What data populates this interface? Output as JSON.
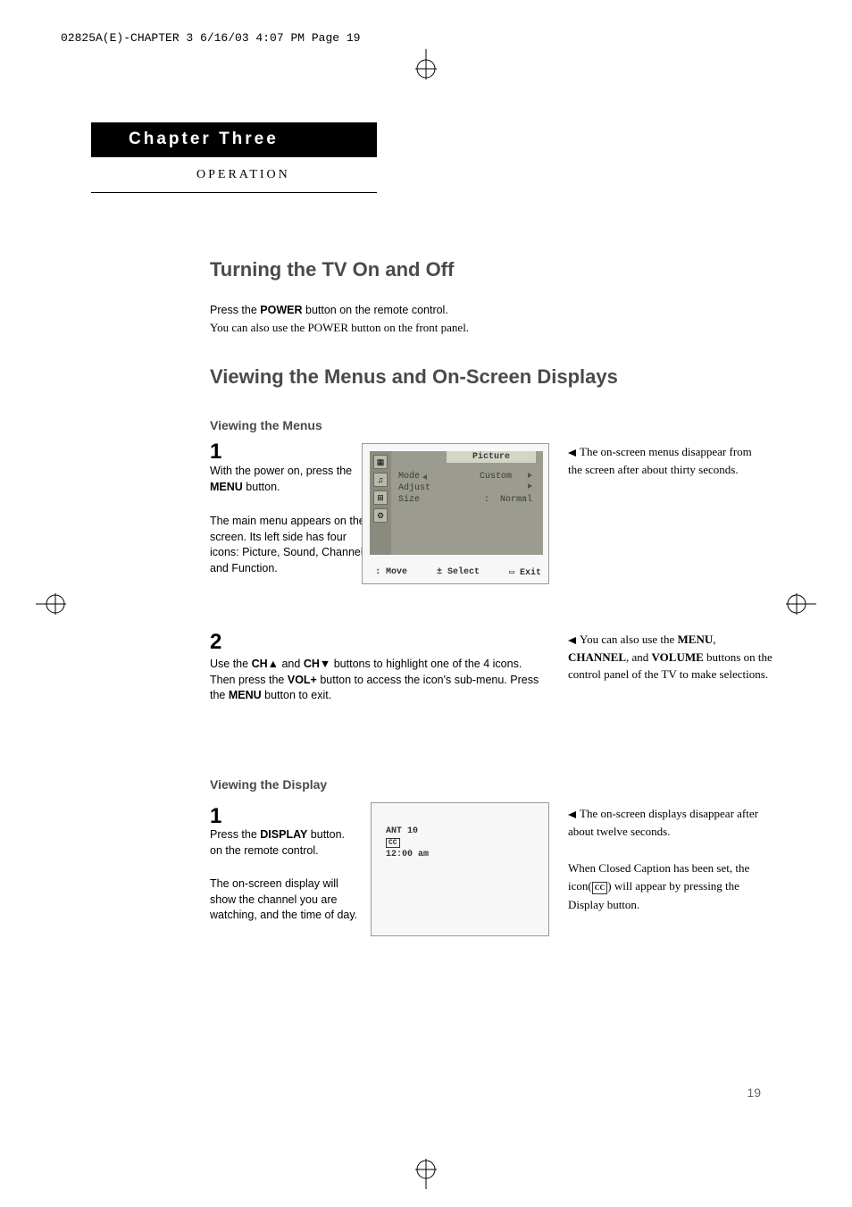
{
  "print_header": "02825A(E)-CHAPTER 3  6/16/03  4:07 PM  Page 19",
  "chapter": "Chapter Three",
  "operation": "OPERATION",
  "section1": {
    "heading": "Turning the TV On and Off",
    "line1_a": "Press the ",
    "line1_b": "POWER",
    "line1_c": " button on the remote control.",
    "line2": "You can also use the POWER button on the front panel."
  },
  "section2": {
    "heading": "Viewing the Menus and On-Screen Displays",
    "sub1": "Viewing the Menus",
    "step1": {
      "num": "1",
      "text1_a": "With the power on, press the ",
      "text1_b": "MENU",
      "text1_c": " button.",
      "text2": "The main menu appears on the screen. Its left side has four icons: Picture, Sound, Channel, and Function."
    },
    "tv_menu": {
      "title": "Picture",
      "rows": {
        "mode_label": "Mode",
        "mode_value": "Custom",
        "adjust_label": "Adjust",
        "size_label": "Size",
        "size_value": "Normal"
      },
      "footer": {
        "move": "Move",
        "select": "Select",
        "exit": "Exit"
      }
    },
    "note1": "The on-screen menus disappear from the screen after about thirty seconds.",
    "step2": {
      "num": "2",
      "a": "Use the ",
      "b": "CH",
      "c": " and ",
      "d": "CH",
      "e": " buttons to highlight one of the 4 icons. Then press the ",
      "f": "VOL+",
      "g": " button to access the icon's sub-menu. Press the ",
      "h": "MENU",
      "i": " button to exit."
    },
    "note2_a": "You can also use the ",
    "note2_b": "MENU",
    "note2_c": ", ",
    "note2_d": "CHANNEL",
    "note2_e": ", and ",
    "note2_f": "VOLUME",
    "note2_g": " buttons on the control panel of the TV to make selections.",
    "sub2": "Viewing the Display",
    "stepD1": {
      "num": "1",
      "text1_a": "Press the ",
      "text1_b": "DISPLAY",
      "text1_c": " button. on the remote control.",
      "text2": "The on-screen display will show the channel you are watching, and the time of day."
    },
    "tv_display": {
      "line1": "ANT  10",
      "cc": "CC",
      "time": "12:00 am"
    },
    "note3": "The on-screen displays disappear after about twelve seconds.",
    "note4_a": "When Closed Caption has been set, the icon(",
    "note4_b": "CC",
    "note4_c": ") will appear by pressing the Display button."
  },
  "page_number": "19"
}
